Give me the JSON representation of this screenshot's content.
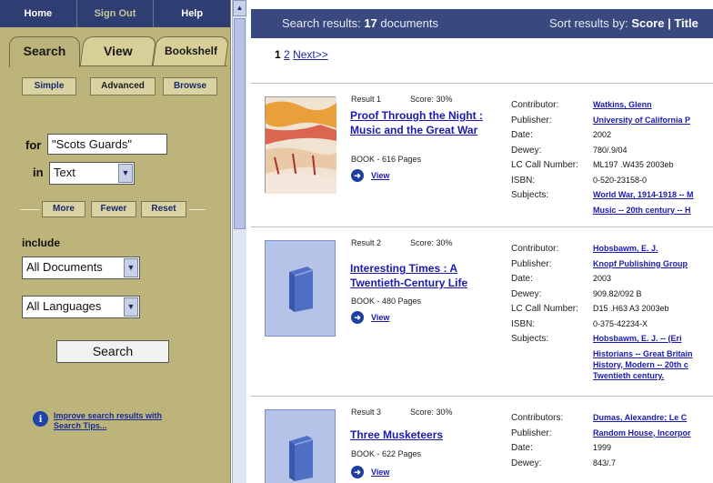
{
  "top_nav": {
    "home": "Home",
    "sign_out": "Sign Out",
    "help": "Help"
  },
  "tabs": {
    "search": "Search",
    "view": "View",
    "bookshelf": "Bookshelf"
  },
  "modes": {
    "simple": "Simple",
    "advanced": "Advanced",
    "browse": "Browse"
  },
  "query": {
    "for_label": "for",
    "value": "\"Scots Guards\"",
    "in_label": "in",
    "field": "Text"
  },
  "row_buttons": {
    "more": "More",
    "fewer": "Fewer",
    "reset": "Reset"
  },
  "include": {
    "label": "include",
    "documents": "All Documents",
    "languages": "All Languages"
  },
  "search_button": "Search",
  "tip_link": "Improve search results with Search Tips...",
  "results_header": {
    "prefix": "Search results: ",
    "count": "17",
    "suffix": " documents",
    "sort_prefix": "Sort results by: ",
    "sort_value": "Score",
    "sort_more": " | Title"
  },
  "pager": {
    "current": "1",
    "next_page": "2",
    "next_label": "Next>>"
  },
  "results": [
    {
      "num": "Result 1",
      "score": "Score: 30%",
      "title": "Proof Through the Night : Music and the Great War",
      "format": "BOOK - 616 Pages",
      "view": "View",
      "meta": {
        "contributor_label": "Contributor:",
        "contributor": "Watkins, Glenn",
        "publisher_label": "Publisher:",
        "publisher": "University of California P",
        "date_label": "Date:",
        "date": "2002",
        "dewey_label": "Dewey:",
        "dewey": "780/.9/04",
        "lc_label": "LC Call Number:",
        "lc": "ML197 .W435 2003eb",
        "isbn_label": "ISBN:",
        "isbn": "0-520-23158-0",
        "subjects_label": "Subjects:",
        "subjects_1": "World War, 1914-1918 -- M",
        "subjects_2": "Music -- 20th century -- H"
      }
    },
    {
      "num": "Result 2",
      "score": "Score: 30%",
      "title": "Interesting Times : A Twentieth-Century Life",
      "format": "BOOK - 480 Pages",
      "view": "View",
      "meta": {
        "contributor_label": "Contributor:",
        "contributor": "Hobsbawm, E. J.",
        "publisher_label": "Publisher:",
        "publisher": "Knopf Publishing Group",
        "date_label": "Date:",
        "date": "2003",
        "dewey_label": "Dewey:",
        "dewey": "909.82/092 B",
        "lc_label": "LC Call Number:",
        "lc": "D15 .H63 A3 2003eb",
        "isbn_label": "ISBN:",
        "isbn": "0-375-42234-X",
        "subjects_label": "Subjects:",
        "subjects_1": "Hobsbawm, E. J. -- (Eri",
        "subjects_2": "Historians -- Great Britain",
        "subjects_3": "History, Modern -- 20th c",
        "subjects_4": "Twentieth century."
      }
    },
    {
      "num": "Result 3",
      "score": "Score: 30%",
      "title": "Three Musketeers",
      "format": "BOOK - 622 Pages",
      "view": "View",
      "meta": {
        "contributor_label": "Contributors:",
        "contributor": "Dumas, Alexandre; Le C",
        "publisher_label": "Publisher:",
        "publisher": "Random House, Incorpor",
        "date_label": "Date:",
        "date": "1999",
        "dewey_label": "Dewey:",
        "dewey": "843/.7"
      }
    }
  ]
}
